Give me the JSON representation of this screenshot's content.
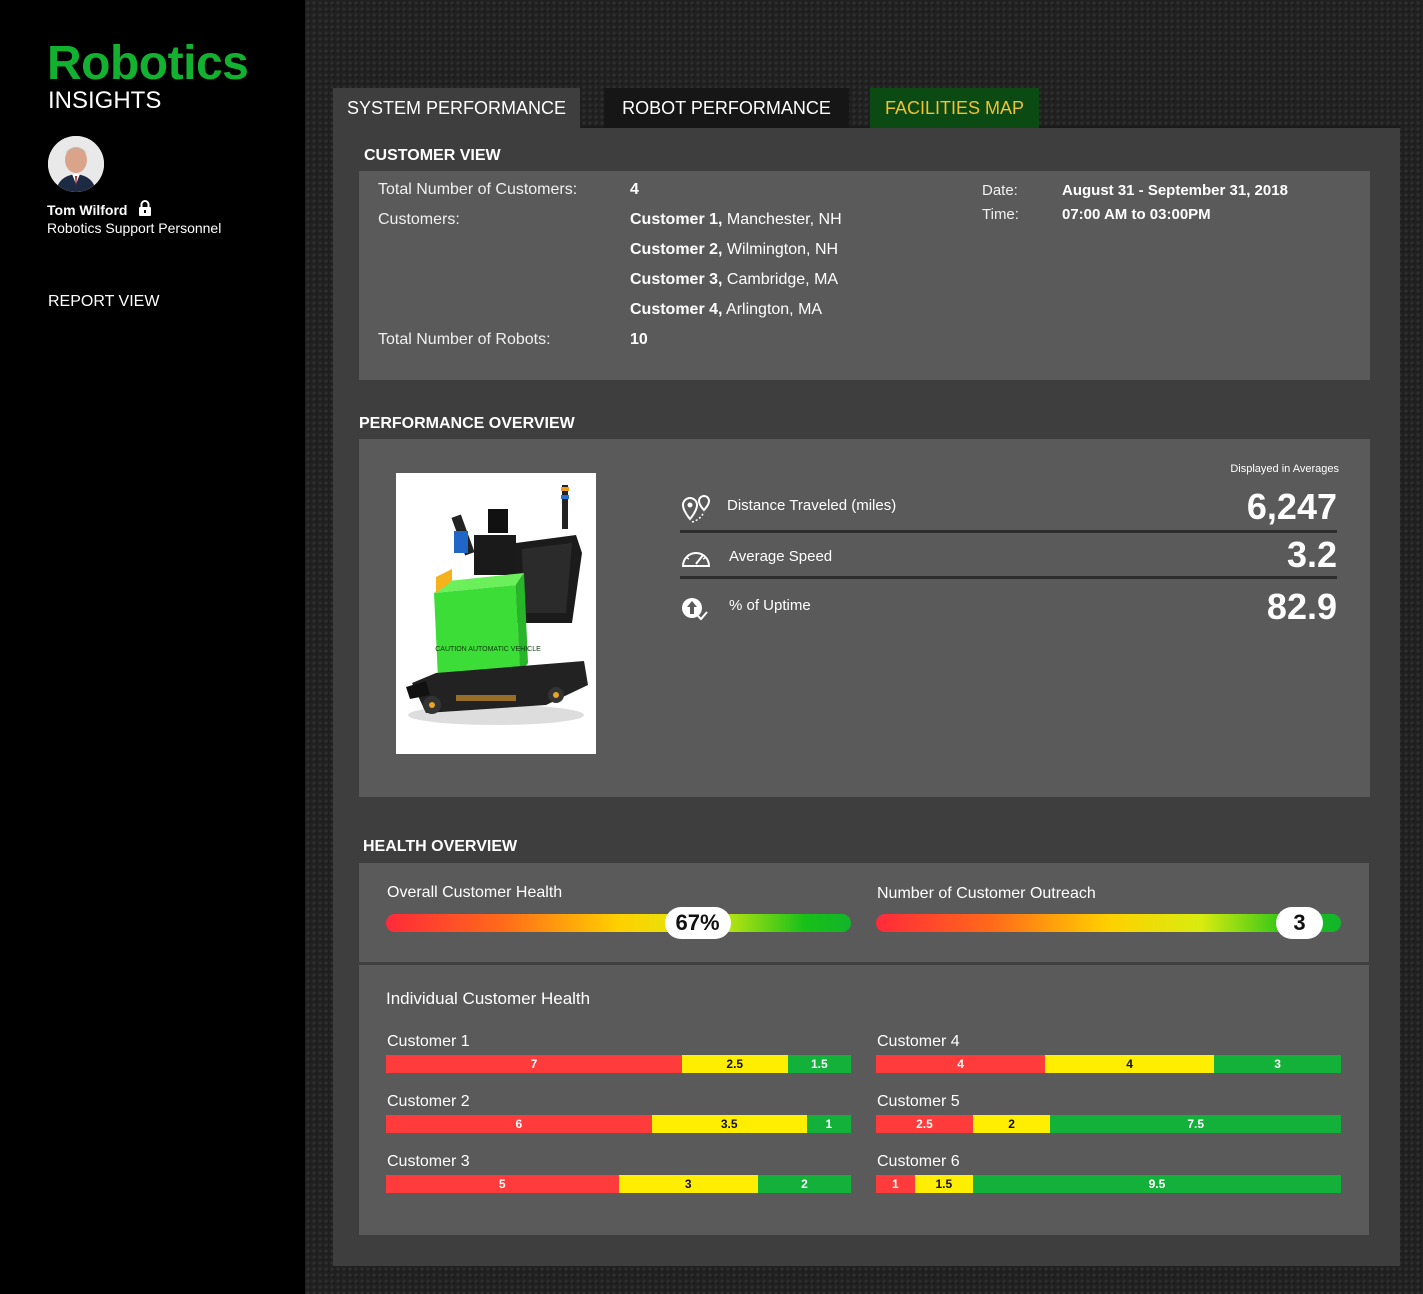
{
  "brand": {
    "title": "Robotics",
    "subtitle": "INSIGHTS",
    "accent": "#13b130"
  },
  "user": {
    "name": "Tom Wilford",
    "role": "Robotics Support Personnel"
  },
  "nav": {
    "report_view": "REPORT VIEW"
  },
  "tabs": [
    {
      "label": "SYSTEM PERFORMANCE",
      "active": true
    },
    {
      "label": "ROBOT PERFORMANCE",
      "active": false
    },
    {
      "label": "FACILITIES MAP",
      "active": false
    }
  ],
  "customer_view": {
    "title": "CUSTOMER VIEW",
    "total_customers_label": "Total Number of Customers:",
    "total_customers": "4",
    "customers_label": "Customers:",
    "customers": [
      {
        "name": "Customer 1,",
        "location": " Manchester, NH"
      },
      {
        "name": "Customer 2,",
        "location": " Wilmington, NH"
      },
      {
        "name": "Customer 3,",
        "location": " Cambridge, MA"
      },
      {
        "name": "Customer 4,",
        "location": " Arlington, MA"
      }
    ],
    "total_robots_label": "Total Number of Robots:",
    "total_robots": "10",
    "date_label": "Date:",
    "date_value": "August 31 - September 31, 2018",
    "time_label": "Time:",
    "time_value": "07:00 AM to 03:00PM"
  },
  "performance": {
    "title": "PERFORMANCE OVERVIEW",
    "note": "Displayed in Averages",
    "vehicle_caption": "CAUTION AUTOMATIC VEHICLE",
    "metrics": [
      {
        "label": "Distance Traveled (miles)",
        "value": "6,247",
        "icon": "location-pins-icon"
      },
      {
        "label": "Average Speed",
        "value": "3.2",
        "icon": "speedometer-icon"
      },
      {
        "label": "% of Uptime",
        "value": "82.9",
        "icon": "uptime-icon"
      }
    ]
  },
  "health": {
    "title": "HEALTH OVERVIEW",
    "overall_label": "Overall Customer Health",
    "overall_value": "67%",
    "overall_fraction": 0.67,
    "outreach_label": "Number of Customer Outreach",
    "outreach_value": "3",
    "individual_title": "Individual Customer Health",
    "customers": [
      {
        "name": "Customer 1",
        "red": 7,
        "yellow": 2.5,
        "green": 1.5
      },
      {
        "name": "Customer 2",
        "red": 6,
        "yellow": 3.5,
        "green": 1
      },
      {
        "name": "Customer 3",
        "red": 5,
        "yellow": 3,
        "green": 2
      },
      {
        "name": "Customer 4",
        "red": 4,
        "yellow": 4,
        "green": 3
      },
      {
        "name": "Customer 5",
        "red": 2.5,
        "yellow": 2,
        "green": 7.5
      },
      {
        "name": "Customer 6",
        "red": 1,
        "yellow": 1.5,
        "green": 9.5
      }
    ]
  }
}
